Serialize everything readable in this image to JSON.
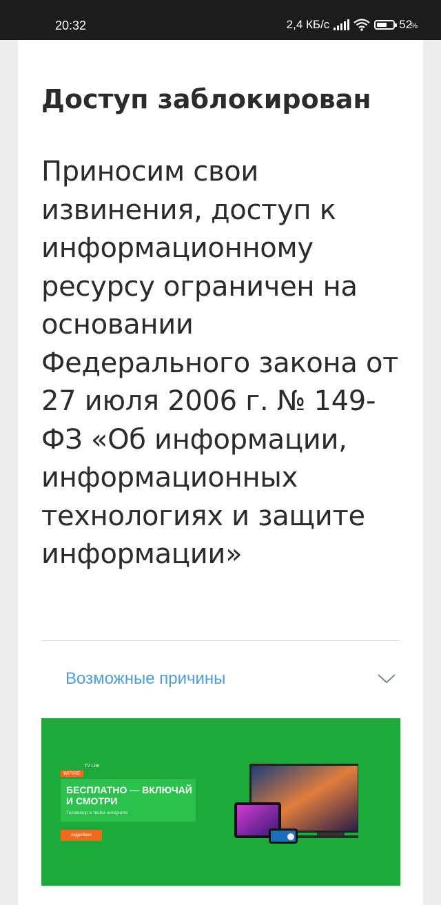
{
  "status_bar": {
    "time": "20:32",
    "network_speed": "2,4 КБ/с",
    "battery_percent": "52",
    "battery_unit": "%"
  },
  "page": {
    "title": "Доступ заблокирован",
    "message": "Приносим свои извинения, доступ к информационному ресурсу ограничен на основании Федерального закона от 27 июля 2006 г. № 149-ФЗ «Об информации, информационных технологиях и защите информации»"
  },
  "reasons": {
    "label": "Возможные причины",
    "icon": "chevron-down-icon"
  },
  "banner": {
    "brand": "WIFIRE",
    "tag": "TV Lite",
    "headline": "БЕСПЛАТНО — ВКЛЮЧАЙ И СМОТРИ",
    "subtitle": "Телевизор в твоём интернете",
    "button_label": "подробнее",
    "background_color": "#1ea93c",
    "accent_color": "#f26a1b"
  }
}
